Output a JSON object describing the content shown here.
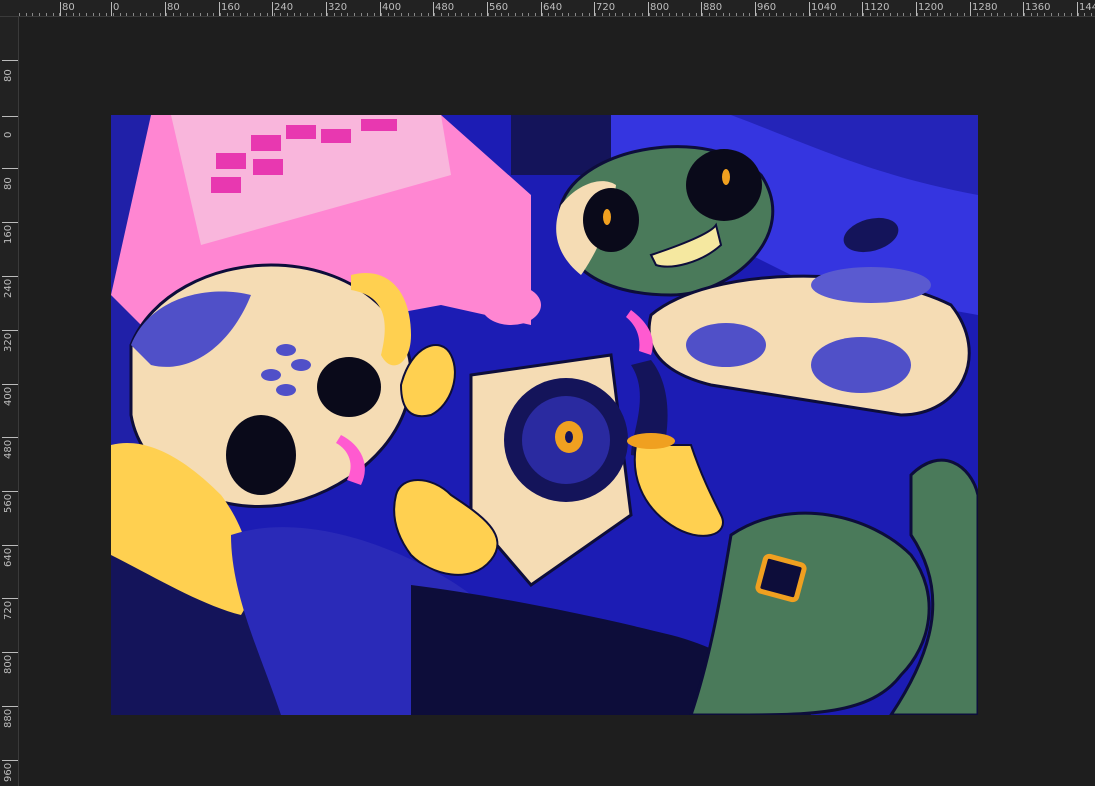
{
  "rulers": {
    "horizontal_labels": [
      "80",
      "0",
      "80",
      "160",
      "240",
      "320",
      "400",
      "480",
      "560",
      "640",
      "720",
      "800",
      "880",
      "960",
      "1040",
      "1120",
      "1200",
      "1280",
      "1360",
      "144"
    ],
    "vertical_labels": [
      "80",
      "0",
      "80",
      "160",
      "240",
      "320",
      "400",
      "480",
      "560",
      "640",
      "720",
      "800",
      "880",
      "960"
    ]
  },
  "colors": {
    "workspace": "#1e1e1e",
    "ruler": "#222222",
    "canvas_bg": "#1a1aa0",
    "pink": "#ff80d0",
    "cream": "#f5dcb4",
    "yellow": "#ffd050",
    "green": "#4a7a5a",
    "navy": "#14145a"
  },
  "artwork": {
    "description_icon": "illustration-canvas"
  }
}
